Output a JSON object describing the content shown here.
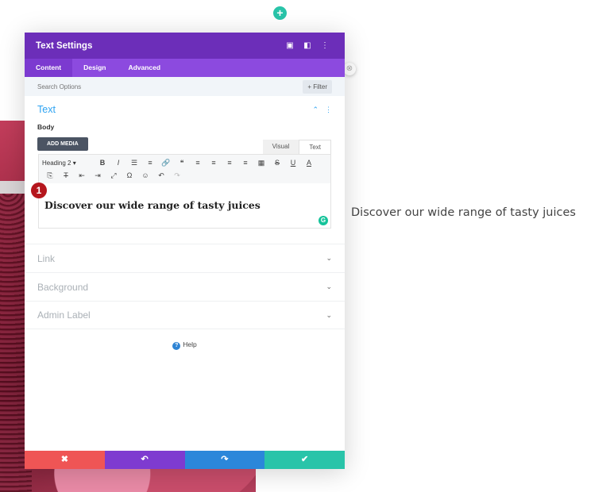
{
  "modal": {
    "title": "Text Settings",
    "header_icons": [
      "expand-icon",
      "columns-icon",
      "more-vertical-icon"
    ],
    "tabs": [
      {
        "label": "Content"
      },
      {
        "label": "Design"
      },
      {
        "label": "Advanced"
      }
    ],
    "active_tab": "Content",
    "search": {
      "placeholder": "Search Options"
    },
    "filter_label": "+ Filter"
  },
  "text_section": {
    "title": "Text",
    "body_label": "Body",
    "add_media_label": "ADD MEDIA",
    "editor_tabs": [
      {
        "label": "Visual"
      },
      {
        "label": "Text"
      }
    ],
    "active_editor_tab": "Text",
    "toolbar": {
      "format_select": "Heading 2",
      "row1": [
        "B",
        "I",
        "☰",
        "≡",
        "🔗",
        "❝",
        "≡",
        "≡",
        "≡",
        "≡",
        "▦",
        "S",
        "U",
        "A"
      ],
      "row2": [
        "⎘",
        "T",
        "⇤",
        "⇥",
        "⤢",
        "Ω",
        "☺",
        "↶",
        "↷"
      ]
    },
    "content": "Discover our wide range of tasty juices"
  },
  "step_marker": "1",
  "collapsed_sections": [
    {
      "label": "Link"
    },
    {
      "label": "Background"
    },
    {
      "label": "Admin Label"
    }
  ],
  "help_label": "Help",
  "preview_text": "Discover our wide range of tasty juices",
  "footer": {
    "buttons": [
      {
        "name": "cancel",
        "glyph": "✖",
        "color": "#ef5555"
      },
      {
        "name": "undo",
        "glyph": "↶",
        "color": "#7e3bd0"
      },
      {
        "name": "redo",
        "glyph": "↷",
        "color": "#2b87da"
      },
      {
        "name": "save",
        "glyph": "✔",
        "color": "#29c4a9"
      }
    ]
  },
  "colors": {
    "header": "#6c2eb9",
    "tabs": "#8c4adf",
    "accent_blue": "#2ea3f2",
    "add_green": "#29c4a9"
  }
}
